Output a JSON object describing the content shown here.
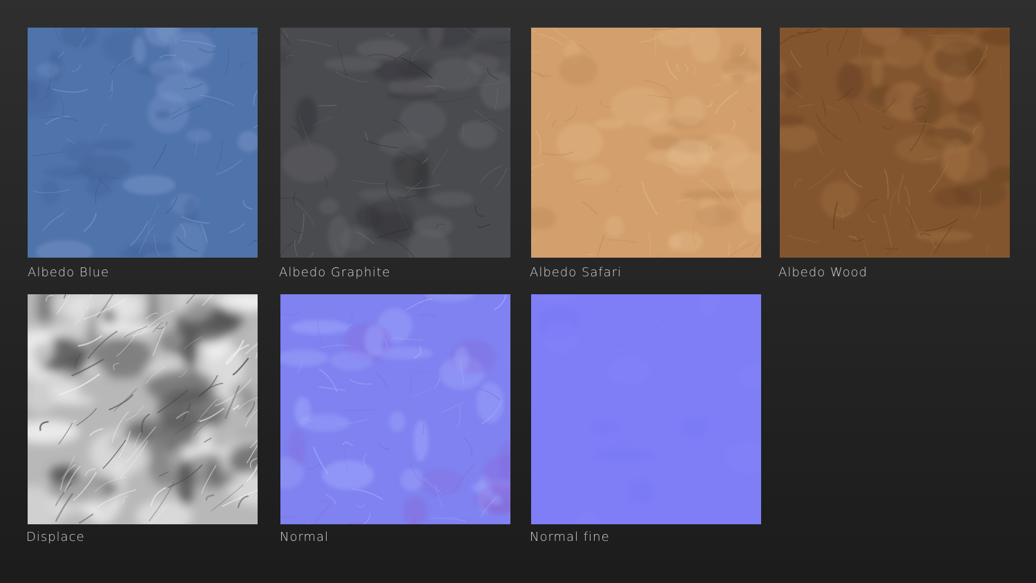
{
  "textures": [
    {
      "label": "Albedo Blue",
      "base_color": "#4f73ab",
      "line_color": "#7f9ccc",
      "dark_color": "#3d5e93",
      "kind": "albedo"
    },
    {
      "label": "Albedo Graphite",
      "base_color": "#4a4b4f",
      "line_color": "#6a6b70",
      "dark_color": "#2e2f33",
      "kind": "albedo"
    },
    {
      "label": "Albedo Safari",
      "base_color": "#d3a06d",
      "line_color": "#e2b889",
      "dark_color": "#b98555",
      "kind": "albedo"
    },
    {
      "label": "Albedo Wood",
      "base_color": "#83552f",
      "line_color": "#a67546",
      "dark_color": "#5f3b1e",
      "kind": "albedo"
    },
    {
      "label": "Displace",
      "base_color": "#b8b8b8",
      "line_color": "#f2f2f2",
      "dark_color": "#4a4a4a",
      "kind": "displace"
    },
    {
      "label": "Normal",
      "base_color": "#7f82f0",
      "line_color": "#a6b0ff",
      "dark_color": "#8a68d8",
      "kind": "normal"
    },
    {
      "label": "Normal fine",
      "base_color": "#7f7ef7",
      "line_color": "#8c8cfa",
      "dark_color": "#7474f2",
      "kind": "normal-fine"
    }
  ]
}
